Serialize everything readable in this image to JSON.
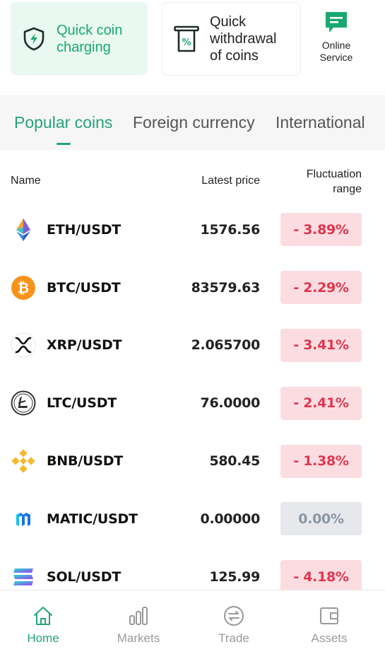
{
  "quick_actions": {
    "charge_label": "Quick coin charging",
    "withdraw_label": "Quick withdrawal of coins",
    "online_label": "Online Service",
    "accent_color": "#1aa872"
  },
  "tabs": [
    {
      "label": "Popular coins",
      "active": true
    },
    {
      "label": "Foreign currency",
      "active": false
    },
    {
      "label": "International",
      "active": false
    }
  ],
  "table_header": {
    "name": "Name",
    "price": "Latest price",
    "fluctuation": "Fluctuation range"
  },
  "markets": [
    {
      "pair": "ETH/USDT",
      "price": "1576.56",
      "change": "- 3.89%",
      "direction": "down",
      "icon": "eth-icon"
    },
    {
      "pair": "BTC/USDT",
      "price": "83579.63",
      "change": "- 2.29%",
      "direction": "down",
      "icon": "btc-icon"
    },
    {
      "pair": "XRP/USDT",
      "price": "2.065700",
      "change": "- 3.41%",
      "direction": "down",
      "icon": "xrp-icon"
    },
    {
      "pair": "LTC/USDT",
      "price": "76.0000",
      "change": "- 2.41%",
      "direction": "down",
      "icon": "ltc-icon"
    },
    {
      "pair": "BNB/USDT",
      "price": "580.45",
      "change": "- 1.38%",
      "direction": "down",
      "icon": "bnb-icon"
    },
    {
      "pair": "MATIC/USDT",
      "price": "0.00000",
      "change": "0.00%",
      "direction": "flat",
      "icon": "matic-icon"
    },
    {
      "pair": "SOL/USDT",
      "price": "125.99",
      "change": "- 4.18%",
      "direction": "down",
      "icon": "sol-icon"
    }
  ],
  "bottom_nav": [
    {
      "label": "Home",
      "active": true,
      "icon": "home-icon"
    },
    {
      "label": "Markets",
      "active": false,
      "icon": "markets-icon"
    },
    {
      "label": "Trade",
      "active": false,
      "icon": "trade-icon"
    },
    {
      "label": "Assets",
      "active": false,
      "icon": "assets-icon"
    }
  ],
  "colors": {
    "brand": "#26a17b",
    "down_bg": "#fbdde1",
    "down_text": "#e0364f",
    "flat_bg": "#e6e8ec",
    "flat_text": "#8a96a3"
  }
}
